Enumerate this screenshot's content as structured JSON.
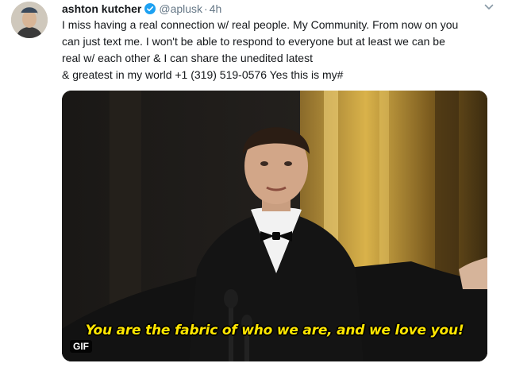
{
  "tweet": {
    "author_name": "ashton kutcher",
    "handle": "@aplusk",
    "separator": "·",
    "time": "4h",
    "text_lines": [
      "I miss having a real connection w/ real people. My Community. From now on you",
      "can just text me. I won't be able to respond to everyone but at least we can be",
      "real w/ each other & I can share the unedited latest",
      "& greatest in my world +1 (319) 519-0576 Yes this is my#"
    ],
    "media": {
      "caption": "You are the fabric of who we are, and we love you!",
      "badge": "GIF"
    }
  },
  "icons": {
    "verified": "verified-badge-icon",
    "more": "chevron-down-icon"
  },
  "colors": {
    "verified": "#1da1f2",
    "caption": "#ffe600",
    "secondary_text": "#657786"
  }
}
